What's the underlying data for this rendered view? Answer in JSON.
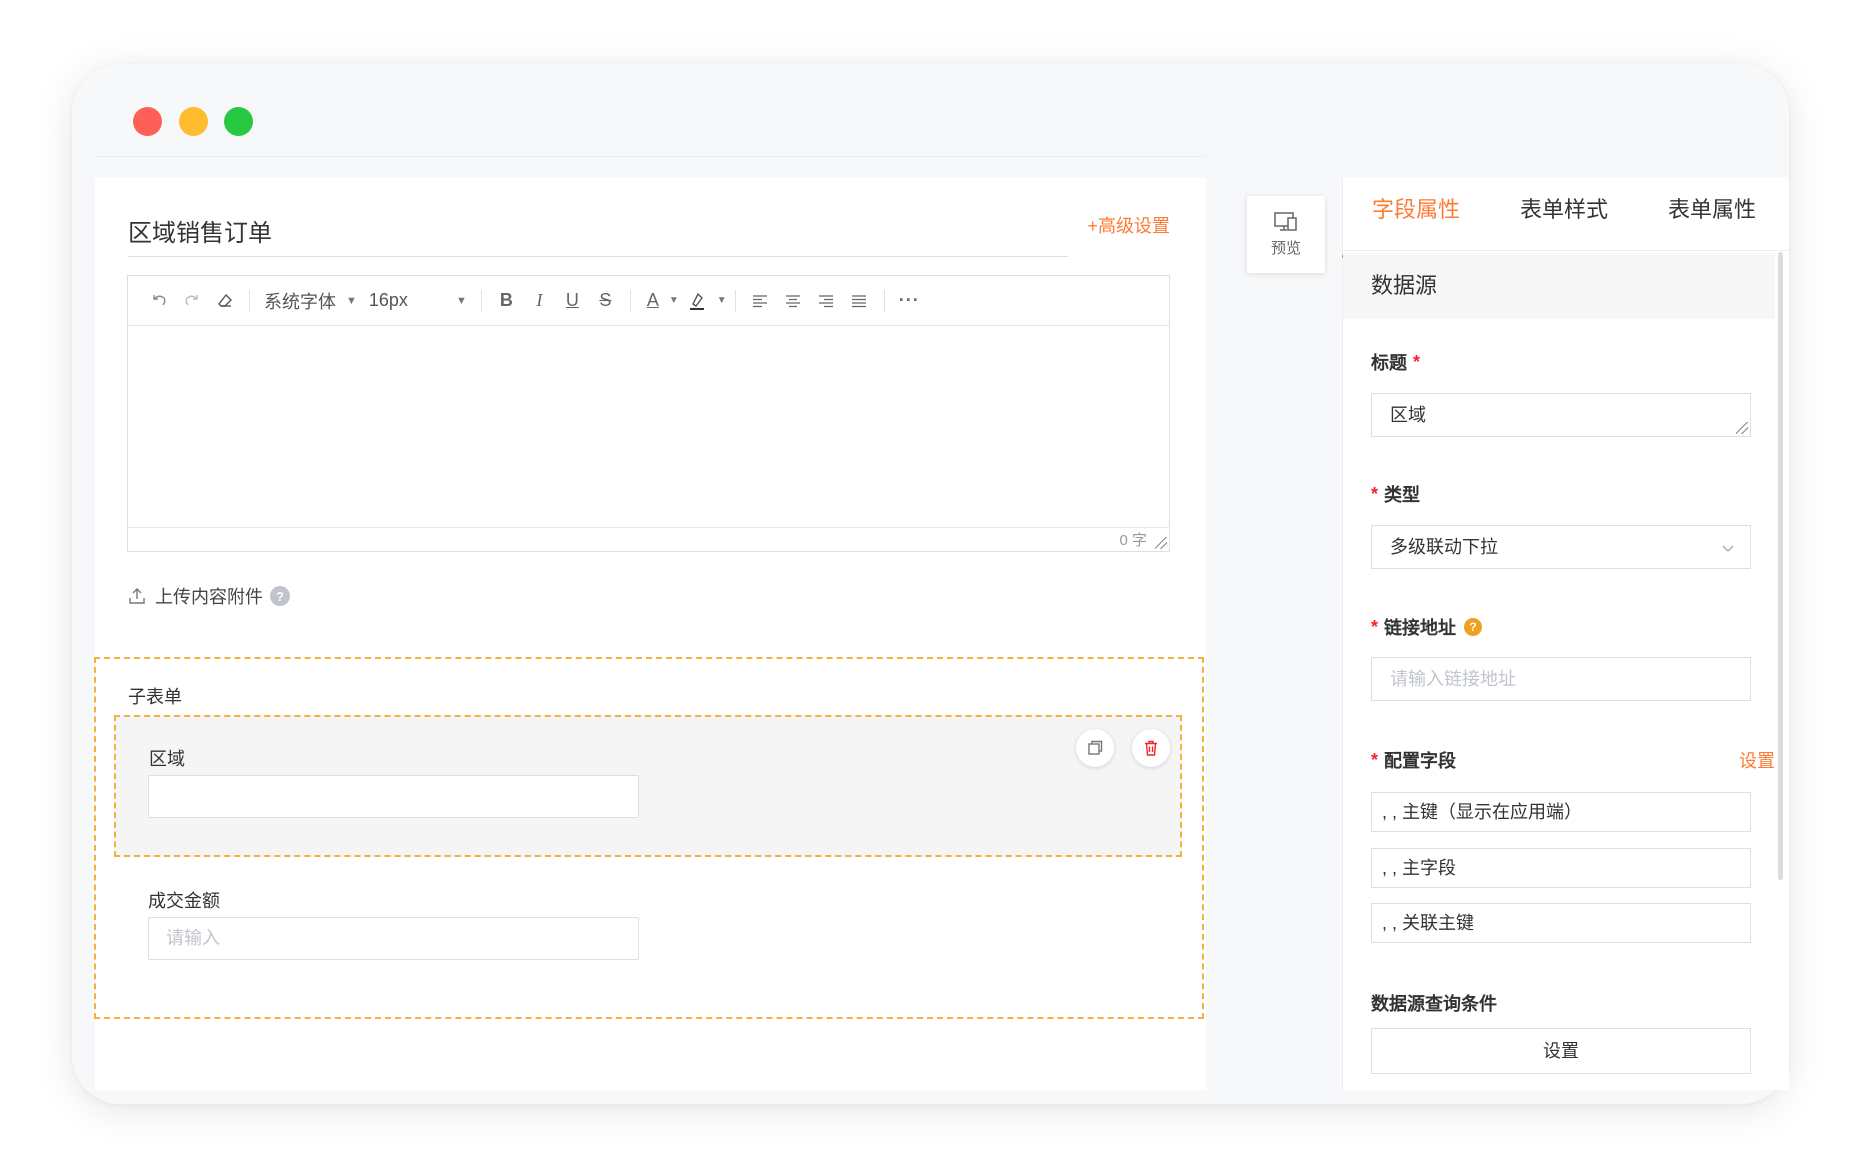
{
  "window": {
    "controls": [
      "close",
      "minimize",
      "maximize"
    ]
  },
  "form": {
    "title": "区域销售订单",
    "advanced_link": "+高级设置",
    "editor": {
      "font_family": "系统字体",
      "font_size": "16px",
      "word_count": "0 字"
    },
    "upload_label": "上传内容附件",
    "help_mark": "?",
    "subform": {
      "label": "子表单",
      "field_label": "区域",
      "field_value": "",
      "amount_label": "成交金额",
      "amount_placeholder": "请输入"
    }
  },
  "preview": {
    "label": "预览"
  },
  "panel": {
    "tabs": [
      {
        "label": "字段属性",
        "active": true
      },
      {
        "label": "表单样式",
        "active": false
      },
      {
        "label": "表单属性",
        "active": false
      }
    ],
    "section_title": "数据源",
    "title_label": "标题",
    "title_value": "区域",
    "type_label": "类型",
    "type_value": "多级联动下拉",
    "link_label": "链接地址",
    "link_placeholder": "请输入链接地址",
    "config_label": "配置字段",
    "config_setting": "设置",
    "config_fields": [
      ", , 主键（显示在应用端）",
      ", , 主字段",
      ", , 关联主键"
    ],
    "query_label": "数据源查询条件",
    "query_button": "设置",
    "required_mark": "*",
    "info_mark": "?"
  },
  "colors": {
    "accent": "#ff7b33",
    "required": "#f5222d",
    "dashed_border": "#f5b140"
  }
}
